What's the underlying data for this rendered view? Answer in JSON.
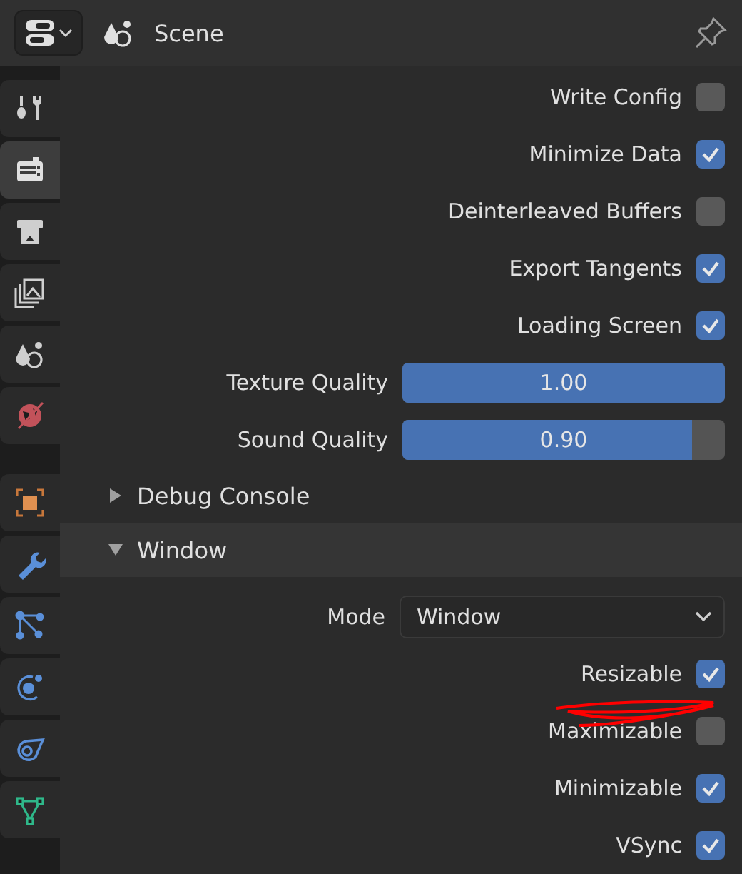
{
  "header": {
    "title": "Scene"
  },
  "sidebar": {
    "tabs": [
      {
        "kind": "tool",
        "selected": false
      },
      {
        "kind": "render",
        "selected": true
      },
      {
        "kind": "output",
        "selected": false
      },
      {
        "kind": "viewlayer",
        "selected": false
      },
      {
        "kind": "scene",
        "selected": false
      },
      {
        "kind": "world",
        "selected": false
      },
      {
        "kind": "object",
        "selected": false
      },
      {
        "kind": "modifier",
        "selected": false
      },
      {
        "kind": "particles",
        "selected": false
      },
      {
        "kind": "physics",
        "selected": false
      },
      {
        "kind": "constraint",
        "selected": false
      },
      {
        "kind": "data",
        "selected": false
      }
    ]
  },
  "rows": [
    {
      "kind": "checkbox",
      "label": "Write Config",
      "checked": false
    },
    {
      "kind": "checkbox",
      "label": "Minimize Data",
      "checked": true
    },
    {
      "kind": "checkbox",
      "label": "Deinterleaved Buffers",
      "checked": false
    },
    {
      "kind": "checkbox",
      "label": "Export Tangents",
      "checked": true
    },
    {
      "kind": "checkbox",
      "label": "Loading Screen",
      "checked": true
    },
    {
      "kind": "slider",
      "label": "Texture Quality",
      "value": "1.00",
      "level": 1.0
    },
    {
      "kind": "slider",
      "label": "Sound Quality",
      "value": "0.90",
      "level": 0.9
    }
  ],
  "sections": [
    {
      "title": "Debug Console",
      "expanded": false
    },
    {
      "title": "Window",
      "expanded": true,
      "rows": [
        {
          "kind": "dropdown",
          "label": "Mode",
          "value": "Window"
        },
        {
          "kind": "checkbox",
          "label": "Resizable",
          "checked": true
        },
        {
          "kind": "checkbox",
          "label": "Maximizable",
          "checked": false
        },
        {
          "kind": "checkbox",
          "label": "Minimizable",
          "checked": true
        },
        {
          "kind": "checkbox",
          "label": "VSync",
          "checked": true
        }
      ]
    }
  ]
}
